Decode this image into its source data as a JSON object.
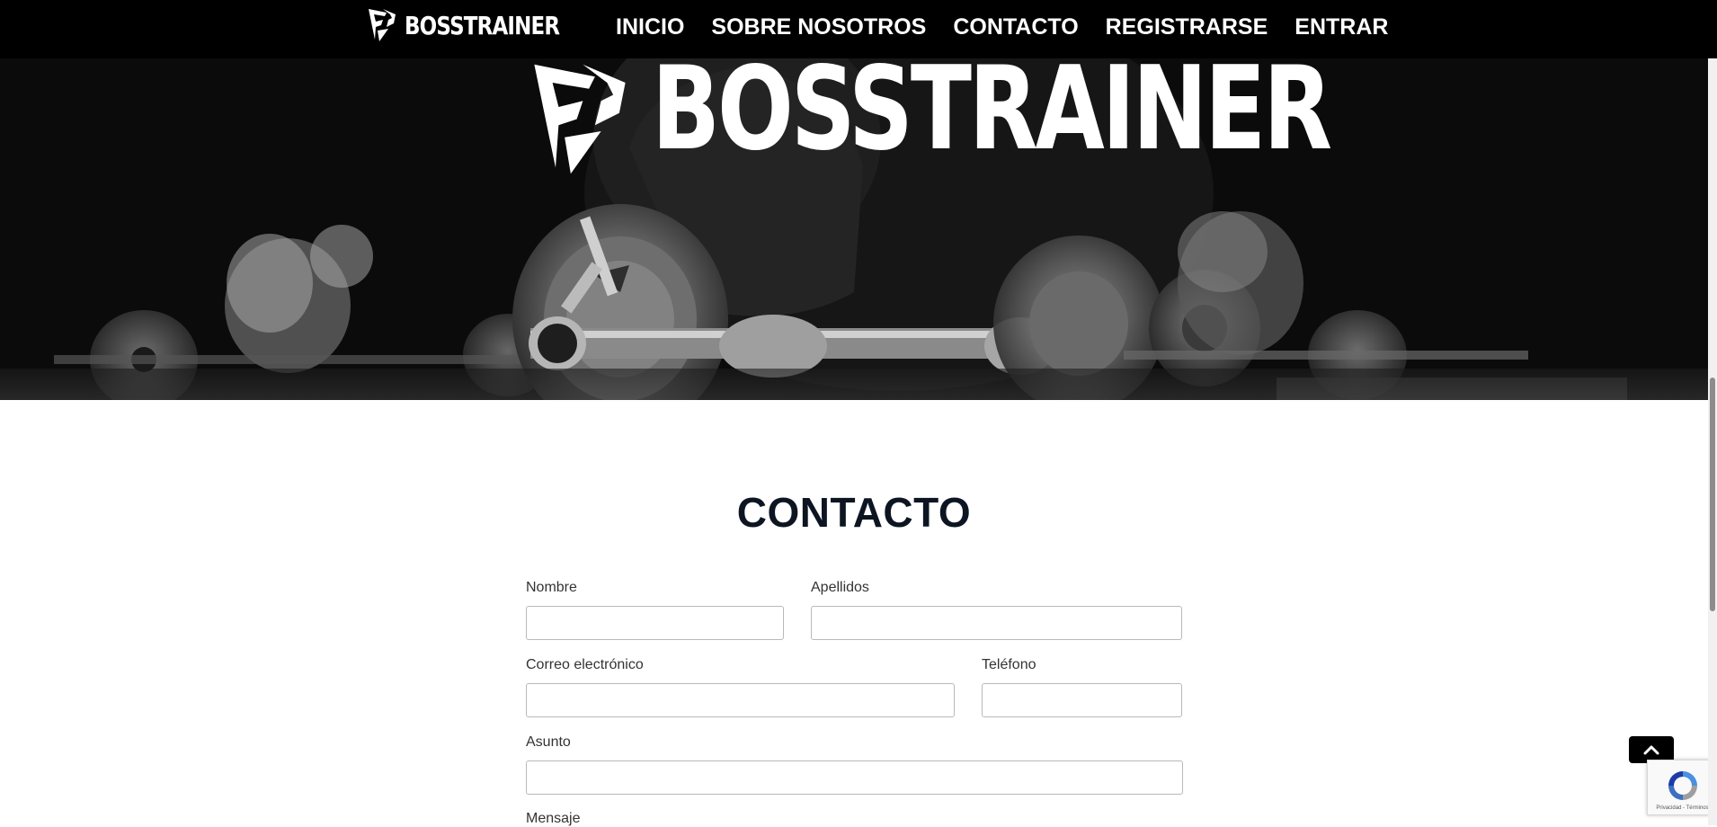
{
  "brand": {
    "name": "BOSSTRAINER"
  },
  "nav": {
    "items": [
      {
        "label": "INICIO"
      },
      {
        "label": "SOBRE NOSOTROS"
      },
      {
        "label": "CONTACTO"
      },
      {
        "label": "REGISTRARSE"
      },
      {
        "label": "ENTRAR"
      }
    ]
  },
  "hero": {
    "logo_text": "BOSSTRAINER"
  },
  "contact": {
    "title": "CONTACTO",
    "fields": {
      "nombre": {
        "label": "Nombre",
        "value": ""
      },
      "apellidos": {
        "label": "Apellidos",
        "value": ""
      },
      "correo": {
        "label": "Correo electrónico",
        "value": ""
      },
      "telefono": {
        "label": "Teléfono",
        "value": ""
      },
      "asunto": {
        "label": "Asunto",
        "value": ""
      },
      "mensaje": {
        "label": "Mensaje"
      }
    }
  },
  "recaptcha": {
    "links": "Privacidad - Términos"
  },
  "icons": {
    "back_to_top": "chevron-up-icon",
    "logo_emblem": "shield-emblem-icon",
    "recaptcha": "recaptcha-icon"
  },
  "colors": {
    "navbar_bg": "#000000",
    "title_color": "#0d1522",
    "text_color": "#333333"
  }
}
